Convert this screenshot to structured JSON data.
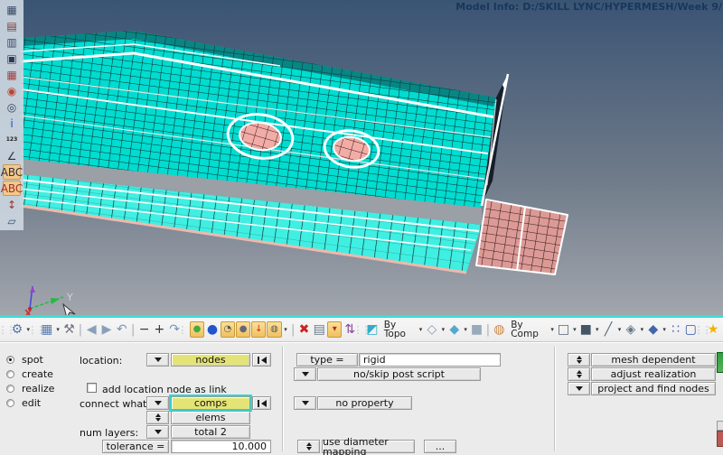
{
  "colors": {
    "bg-top": "#3A5474",
    "bg-mid": "#6E7A89",
    "bg-bottom": "#A3A7AE",
    "mesh-cyan": "#00DCD0",
    "mesh-flange": "#3FEFE2",
    "mesh-grid": "#0C2B2B",
    "washer-pink": "#F2ACA6",
    "patch-pink": "#DC9A96",
    "patch-grid": "#301818",
    "edge-dark": "#151F2B",
    "gray-band": "#9AA0A6",
    "salmon-edge": "#EDB9AF",
    "viewport-border": "#35E0D5",
    "accent-yellow": "#E4E476",
    "focus-cyan": "#2FD6D6",
    "create-green": "#2E9E3E",
    "return-red": "#BB5A55"
  },
  "viewport": {
    "model_info": "Model Info: D:/SKILL LYNC/HYPERMESH/Week 9/",
    "triad": {
      "x": "X",
      "y": "Y"
    }
  },
  "left_toolbar": {
    "icons": [
      {
        "name": "display-entities-icon",
        "glyph": "▦",
        "color": "#3A4A66",
        "variant": "",
        "inter": "true"
      },
      {
        "name": "mask-icon",
        "glyph": "▤",
        "color": "#7A3A3A",
        "variant": "",
        "inter": "true"
      },
      {
        "name": "unmask-adjacent-icon",
        "glyph": "▥",
        "color": "#3A4A66",
        "variant": "",
        "inter": "true"
      },
      {
        "name": "unmask-all-icon",
        "glyph": "▣",
        "color": "#2A3A56",
        "variant": "",
        "inter": "true"
      },
      {
        "name": "reverse-display-icon",
        "glyph": "▦",
        "color": "#A04040",
        "variant": "",
        "inter": "true"
      },
      {
        "name": "spherical-clipping-icon",
        "glyph": "◉",
        "color": "#BB4433",
        "variant": "",
        "inter": "true"
      },
      {
        "name": "find-entities-icon",
        "glyph": "◎",
        "color": "#33445A",
        "variant": "",
        "inter": "true"
      },
      {
        "name": "model-info-icon",
        "glyph": "i",
        "color": "#1155CC",
        "variant": "",
        "inter": "true"
      },
      {
        "name": "numbers-icon",
        "glyph": "123",
        "color": "#222222",
        "variant": "text",
        "inter": "true"
      },
      {
        "name": "measure-icon",
        "glyph": "∠",
        "color": "#223344",
        "variant": "",
        "inter": "true"
      },
      {
        "name": "labels-abc-icon",
        "glyph": "ABC",
        "color": "#334",
        "variant": "highlight",
        "inter": "true"
      },
      {
        "name": "labels-abc-off-icon",
        "glyph": "ABC",
        "color": "#A03030",
        "variant": "highlight",
        "inter": "true"
      },
      {
        "name": "vector-display-icon",
        "glyph": "↕",
        "color": "#993333",
        "variant": "",
        "inter": "true"
      },
      {
        "name": "section-cut-icon",
        "glyph": "▱",
        "color": "#335577",
        "variant": "",
        "inter": "true"
      }
    ]
  },
  "main_toolbar": {
    "items": [
      {
        "kind": "handle",
        "name": "group-handle",
        "glyph": "⋮⋮",
        "color": "#B8BEC6",
        "inter": "false"
      },
      {
        "kind": "icon",
        "name": "user-profile-gear-icon",
        "glyph": "⚙",
        "color": "#5577AA",
        "inter": "true"
      },
      {
        "kind": "caret",
        "name": "user-profile-dropdown-icon",
        "glyph": "▾",
        "color": "#333",
        "inter": "true"
      },
      {
        "kind": "handle",
        "name": "group-handle",
        "glyph": "⋮⋮",
        "color": "#B8BEC6",
        "inter": "false"
      },
      {
        "kind": "icon",
        "name": "page-layout-icon",
        "glyph": "▦",
        "color": "#5577AA",
        "inter": "true"
      },
      {
        "kind": "caret",
        "name": "page-layout-dropdown-icon",
        "glyph": "▾",
        "color": "#333",
        "inter": "true"
      },
      {
        "kind": "icon",
        "name": "wrench-icon",
        "glyph": "⚒",
        "color": "#777788",
        "inter": "true"
      },
      {
        "kind": "sep",
        "name": "separator",
        "glyph": "|",
        "color": "#AAB",
        "inter": "false"
      },
      {
        "kind": "icon",
        "name": "back-arrow-icon",
        "glyph": "◀",
        "color": "#8AA0B8",
        "inter": "true"
      },
      {
        "kind": "icon",
        "name": "forward-arrow-icon",
        "glyph": "▶",
        "color": "#8AA0B8",
        "inter": "true"
      },
      {
        "kind": "icon",
        "name": "undo-icon",
        "glyph": "↶",
        "color": "#7A94B0",
        "inter": "true"
      },
      {
        "kind": "sep",
        "name": "separator",
        "glyph": "|",
        "color": "#AAB",
        "inter": "false"
      },
      {
        "kind": "icon",
        "name": "zoom-out-icon",
        "glyph": "−",
        "color": "#333333",
        "inter": "true"
      },
      {
        "kind": "icon",
        "name": "zoom-in-icon",
        "glyph": "+",
        "color": "#333333",
        "inter": "true"
      },
      {
        "kind": "icon",
        "name": "redo-icon",
        "glyph": "↷",
        "color": "#7A94B0",
        "inter": "true"
      },
      {
        "kind": "handle",
        "name": "group-handle",
        "glyph": "⋮⋮",
        "color": "#B8BEC6",
        "inter": "false"
      },
      {
        "kind": "folder",
        "name": "open-model-icon",
        "glyph": "●",
        "color": "#44AA44",
        "inter": "true"
      },
      {
        "kind": "icon",
        "name": "import-solver-icon",
        "glyph": "●",
        "color": "#2255CC",
        "inter": "true"
      },
      {
        "kind": "folder",
        "name": "load-recent-icon",
        "glyph": "◔",
        "color": "#555555",
        "inter": "true"
      },
      {
        "kind": "folder",
        "name": "save-model-icon",
        "glyph": "●",
        "color": "#667",
        "inter": "true"
      },
      {
        "kind": "folder",
        "name": "export-solver-icon",
        "glyph": "↓",
        "color": "#CC2222",
        "inter": "true"
      },
      {
        "kind": "folder",
        "name": "file-browse-icon",
        "glyph": "◍",
        "color": "#555555",
        "inter": "true"
      },
      {
        "kind": "caret",
        "name": "file-browse-dropdown-icon",
        "glyph": "▾",
        "color": "#333",
        "inter": "true"
      },
      {
        "kind": "sep",
        "name": "separator",
        "glyph": "|",
        "color": "#AAB",
        "inter": "false"
      },
      {
        "kind": "icon",
        "name": "delete-icon",
        "glyph": "✖",
        "color": "#CC2222",
        "inter": "true"
      },
      {
        "kind": "icon",
        "name": "organize-icon",
        "glyph": "▤",
        "color": "#667788",
        "inter": "true"
      },
      {
        "kind": "folder",
        "name": "include-files-icon",
        "glyph": "▾",
        "color": "#AA3322",
        "inter": "true"
      },
      {
        "kind": "icon",
        "name": "renumber-icon",
        "glyph": "⇅",
        "color": "#884499",
        "inter": "true"
      },
      {
        "kind": "handle",
        "name": "group-handle",
        "glyph": "⋮⋮",
        "color": "#B8BEC6",
        "inter": "false"
      },
      {
        "kind": "icon",
        "name": "geometry-color-mode-icon",
        "glyph": "◩",
        "color": "#33AACC",
        "inter": "true"
      },
      {
        "kind": "label",
        "name": "by-topo-selector",
        "glyph": "By Topo",
        "color": "#222",
        "inter": "true"
      },
      {
        "kind": "caret",
        "name": "by-topo-dropdown-icon",
        "glyph": "▾",
        "color": "#333",
        "inter": "true"
      },
      {
        "kind": "icon",
        "name": "surface-wire-icon",
        "glyph": "◇",
        "color": "#8899AA",
        "inter": "true"
      },
      {
        "kind": "caret",
        "name": "surface-wire-dropdown-icon",
        "glyph": "▾",
        "color": "#333",
        "inter": "true"
      },
      {
        "kind": "icon",
        "name": "surface-shaded-icon",
        "glyph": "◆",
        "color": "#55AACC",
        "inter": "true"
      },
      {
        "kind": "caret",
        "name": "surface-shaded-dropdown-icon",
        "glyph": "▾",
        "color": "#333",
        "inter": "true"
      },
      {
        "kind": "icon",
        "name": "solid-shaded-icon",
        "glyph": "■",
        "color": "#99AABB",
        "inter": "true"
      },
      {
        "kind": "sep",
        "name": "separator",
        "glyph": "|",
        "color": "#AAB",
        "inter": "false"
      },
      {
        "kind": "icon",
        "name": "element-color-mode-icon",
        "glyph": "◍",
        "color": "#CC8844",
        "inter": "true"
      },
      {
        "kind": "label",
        "name": "by-comp-selector",
        "glyph": "By Comp",
        "color": "#222",
        "inter": "true"
      },
      {
        "kind": "caret",
        "name": "by-comp-dropdown-icon",
        "glyph": "▾",
        "color": "#333",
        "inter": "true"
      },
      {
        "kind": "icon",
        "name": "mesh-wire-icon",
        "glyph": "□",
        "color": "#556677",
        "inter": "true"
      },
      {
        "kind": "caret",
        "name": "mesh-wire-dropdown-icon",
        "glyph": "▾",
        "color": "#333",
        "inter": "true"
      },
      {
        "kind": "icon",
        "name": "mesh-shaded-icon",
        "glyph": "■",
        "color": "#445566",
        "inter": "true"
      },
      {
        "kind": "caret",
        "name": "mesh-shaded-dropdown-icon",
        "glyph": "▾",
        "color": "#333",
        "inter": "true"
      },
      {
        "kind": "icon",
        "name": "feature-line-icon",
        "glyph": "╱",
        "color": "#556677",
        "inter": "true"
      },
      {
        "kind": "caret",
        "name": "feature-line-dropdown-icon",
        "glyph": "▾",
        "color": "#333",
        "inter": "true"
      },
      {
        "kind": "icon",
        "name": "element-2d-icon",
        "glyph": "◈",
        "color": "#667788",
        "inter": "true"
      },
      {
        "kind": "caret",
        "name": "element-2d-dropdown-icon",
        "glyph": "▾",
        "color": "#333",
        "inter": "true"
      },
      {
        "kind": "icon",
        "name": "element-3d-icon",
        "glyph": "◆",
        "color": "#4466AA",
        "inter": "true"
      },
      {
        "kind": "caret",
        "name": "element-3d-dropdown-icon",
        "glyph": "▾",
        "color": "#333",
        "inter": "true"
      },
      {
        "kind": "icon",
        "name": "visualization-options-icon",
        "glyph": "∷",
        "color": "#5566AA",
        "inter": "true"
      },
      {
        "kind": "icon",
        "name": "performance-monitor-icon",
        "glyph": "▢",
        "color": "#3355AA",
        "inter": "true"
      },
      {
        "kind": "handle",
        "name": "group-handle",
        "glyph": "⋮⋮",
        "color": "#B8BEC6",
        "inter": "false"
      },
      {
        "kind": "icon",
        "name": "favorites-star-icon",
        "glyph": "★",
        "color": "#F0B400",
        "inter": "true"
      }
    ]
  },
  "panel": {
    "modes": [
      {
        "label": "spot",
        "state": "on"
      },
      {
        "label": "create",
        "state": "off"
      },
      {
        "label": "realize",
        "state": "off"
      },
      {
        "label": "edit",
        "state": "off"
      }
    ],
    "location_label": "location:",
    "location_value": "nodes",
    "add_link_label": "add location node as link",
    "connect_label": "connect what:",
    "connect_value": "comps",
    "connect_secondary": "elems",
    "num_layers_label": "num layers:",
    "num_layers_value": "total 2",
    "tolerance_label": "tolerance =",
    "tolerance_value": "10.000",
    "type_label": "type =",
    "type_value": "rigid",
    "post_script_label": "no/skip post script",
    "property_label": "no property",
    "diameter_label": "use diameter mapping",
    "more_label": "...",
    "option_rows": [
      {
        "label": "mesh dependent",
        "toggle": "ud",
        "inter": "true"
      },
      {
        "label": "adjust realization",
        "toggle": "ud",
        "inter": "true"
      },
      {
        "label": "project and find nodes",
        "toggle": "dd",
        "inter": "true"
      }
    ]
  }
}
